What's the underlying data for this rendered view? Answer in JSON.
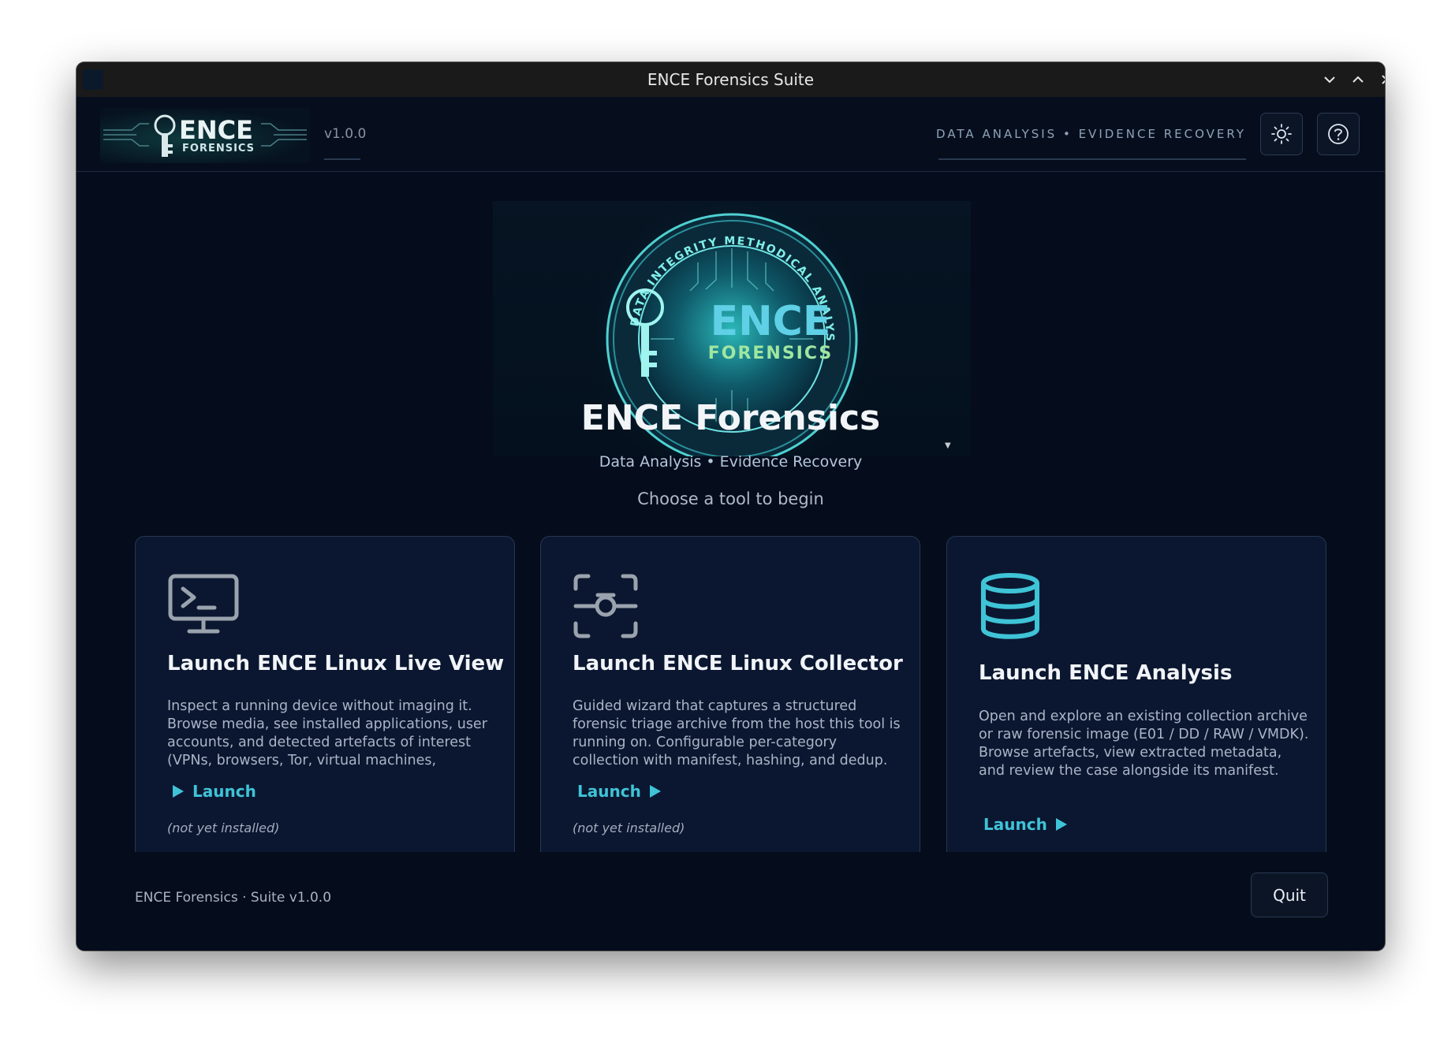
{
  "window": {
    "title": "ENCE Forensics Suite"
  },
  "header": {
    "logo_word": "ENCE",
    "logo_sub": "FORENSICS",
    "version": "v1.0.0",
    "tagline": "DATA ANALYSIS • EVIDENCE RECOVERY",
    "theme_icon": "sun-icon",
    "help_icon": "question-icon"
  },
  "hero": {
    "seal_ring_text": "DATA INTEGRITY METHODICAL ANALYSIS",
    "seal_word": "ENCE",
    "seal_sub": "FORENSICS",
    "title": "ENCE Forensics",
    "subtitle": "Data Analysis • Evidence Recovery",
    "prompt": "Choose a tool to begin"
  },
  "cards": [
    {
      "icon": "terminal-monitor-icon",
      "title": "Launch ENCE Linux Live View",
      "description": "Inspect a running device without imaging it. Browse media, see installed applications, user accounts, and detected artefacts of interest (VPNs, browsers, Tor, virtual machines,",
      "launch_label": "Launch",
      "note": "(not yet installed)"
    },
    {
      "icon": "scan-capture-icon",
      "title": "Launch ENCE Linux Collector",
      "description": "Guided wizard that captures a structured forensic triage archive from the host this tool is running on.  Configurable per-category collection with manifest, hashing, and dedup.",
      "launch_label": "Launch",
      "note": "(not yet installed)"
    },
    {
      "icon": "database-icon",
      "title": "Launch ENCE Analysis",
      "description": "Open and explore an existing collection archive or raw forensic image (E01 / DD / RAW / VMDK).  Browse artefacts, view extracted metadata, and review the case alongside its manifest.",
      "launch_label": "Launch"
    }
  ],
  "footer": {
    "text": "ENCE Forensics  ·  Suite v1.0.0",
    "quit_label": "Quit"
  },
  "colors": {
    "accent": "#3fc3d7",
    "background": "#050d1c",
    "card": "#0b1730"
  }
}
